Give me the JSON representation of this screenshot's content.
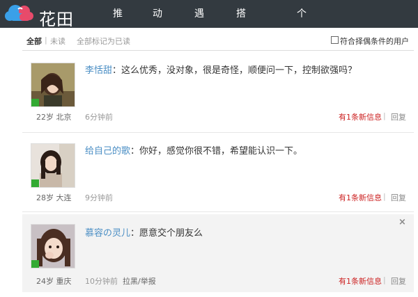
{
  "header": {
    "logo_text": "花田",
    "nav": [
      "推荐",
      "动态",
      "遇见",
      "搭讪广场",
      "个人主页"
    ],
    "ghost_text": "",
    "accent_bg": "#333a40"
  },
  "filter": {
    "all_label": "全部",
    "separator": "|",
    "unread_label": "未读",
    "mark_all_label": "全部标记为已读",
    "checkbox_label": "符合择偶条件的用户"
  },
  "messages": [
    {
      "sender": "李恬甜",
      "colon": "：",
      "content": "这么优秀，没对象，很是奇怪，顺便问一下，控制欲强吗？",
      "age_city": "22岁 北京",
      "time": "6分钟前",
      "new_label": "有1条新信息",
      "pipe": "|",
      "reply_label": "回复"
    },
    {
      "sender": "给自己的歌",
      "colon": "：",
      "content": "你好，感觉你很不错，希望能认识一下。",
      "age_city": "28岁 大连",
      "time": "9分钟前",
      "new_label": "有1条新信息",
      "pipe": "|",
      "reply_label": "回复"
    },
    {
      "sender": "慕容の灵儿",
      "colon": "：",
      "content": "愿意交个朋友么",
      "age_city": "24岁 重庆",
      "time": "10分钟前",
      "report_label": "拉黑/举报",
      "new_label": "有1条新信息",
      "pipe": "|",
      "reply_label": "回复",
      "close_glyph": "×"
    }
  ],
  "colors": {
    "link_blue": "#4a8ec4",
    "new_red": "#cc2222",
    "online_green": "#33aa33"
  }
}
